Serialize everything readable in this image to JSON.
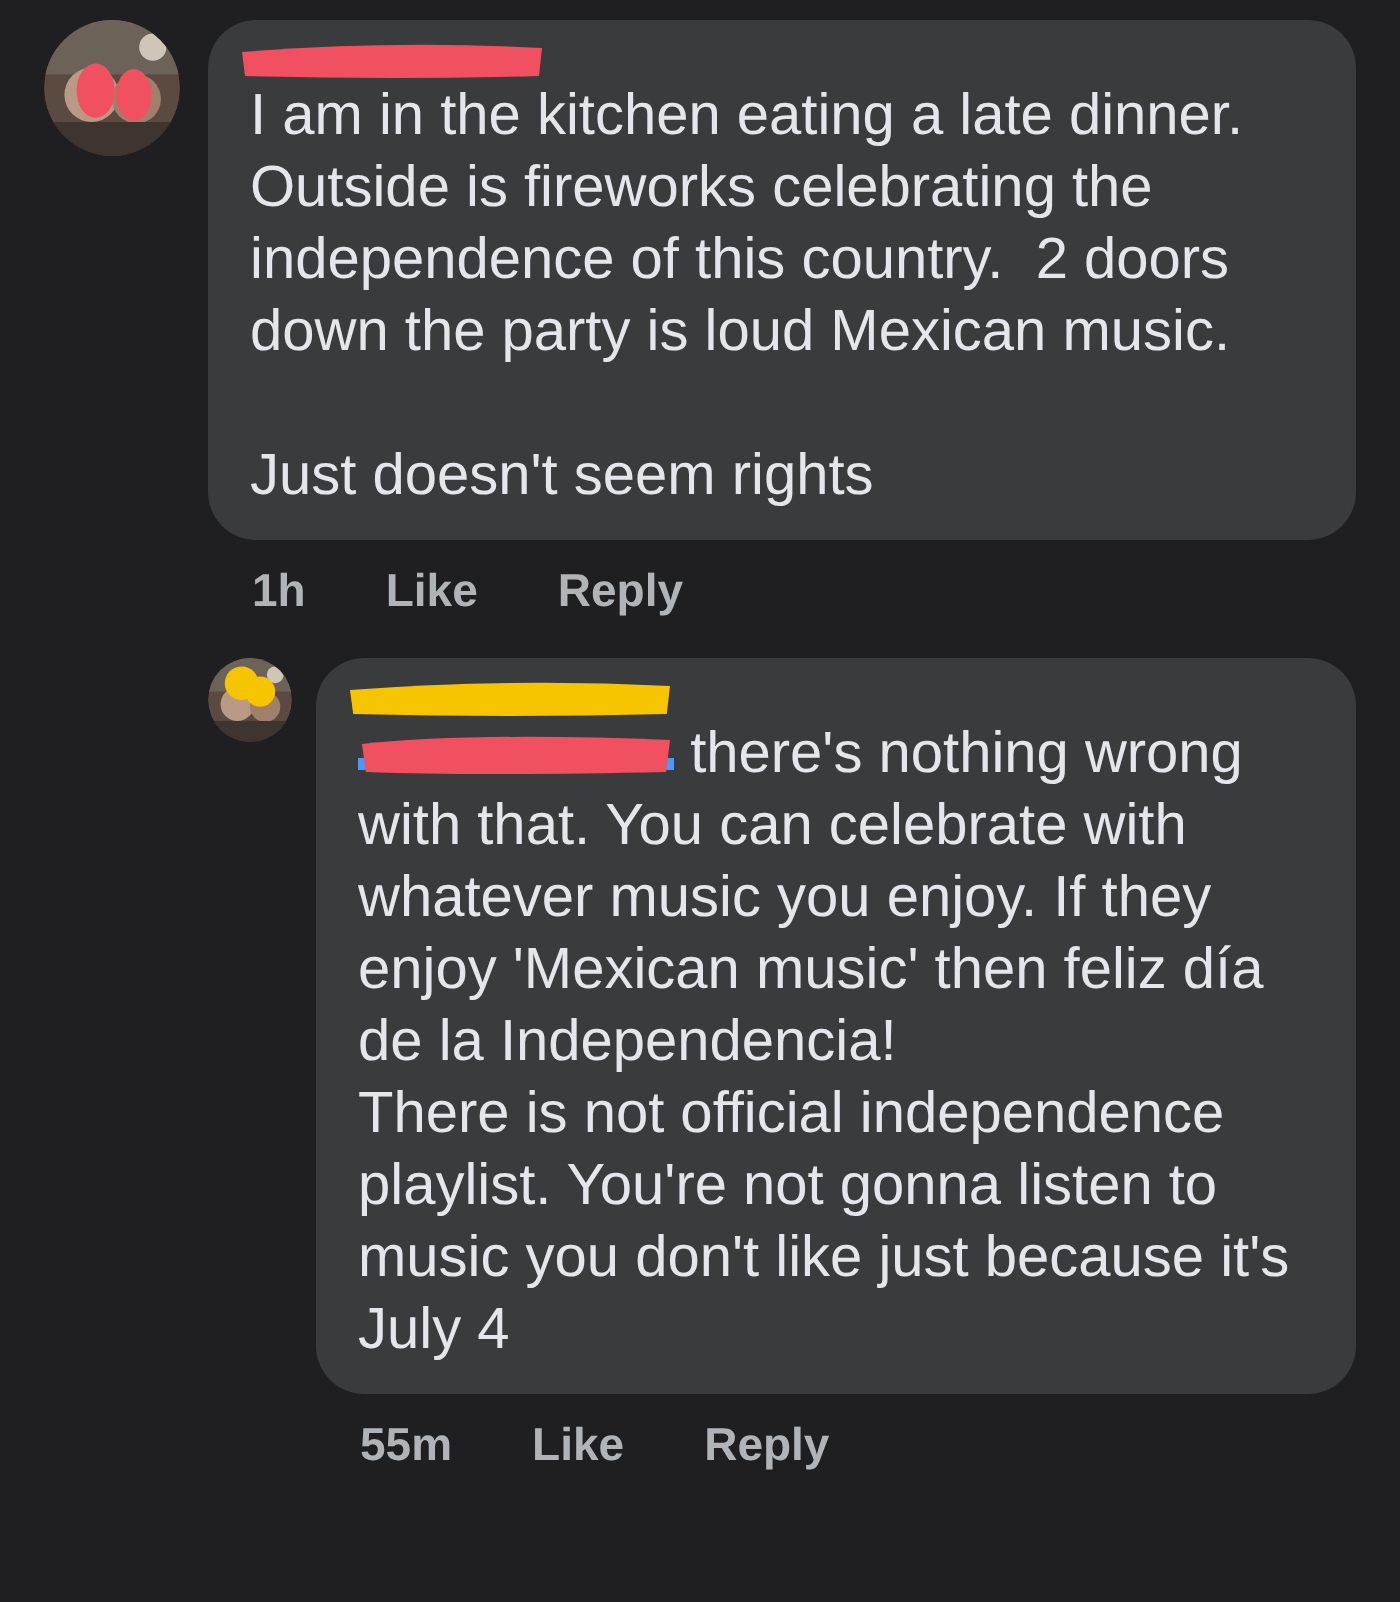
{
  "comments": [
    {
      "author_redacted": true,
      "mention_redacted": false,
      "text": "I am in the kitchen eating a late dinner. Outside is fireworks celebrating the independence of this country.  2 doors down the party is loud Mexican music.\n\nJust doesn't seem rights",
      "time": "1h",
      "actions": [
        "Like",
        "Reply"
      ],
      "reply": false
    },
    {
      "author_redacted": true,
      "mention_redacted": true,
      "text": "there's nothing wrong with that. You can celebrate with whatever music you enjoy. If they enjoy 'Mexican music' then feliz día de la Independencia!\nThere is not official independence playlist. You're not gonna listen to music you don't like just because it's July 4",
      "time": "55m",
      "actions": [
        "Like",
        "Reply"
      ],
      "reply": true
    }
  ]
}
